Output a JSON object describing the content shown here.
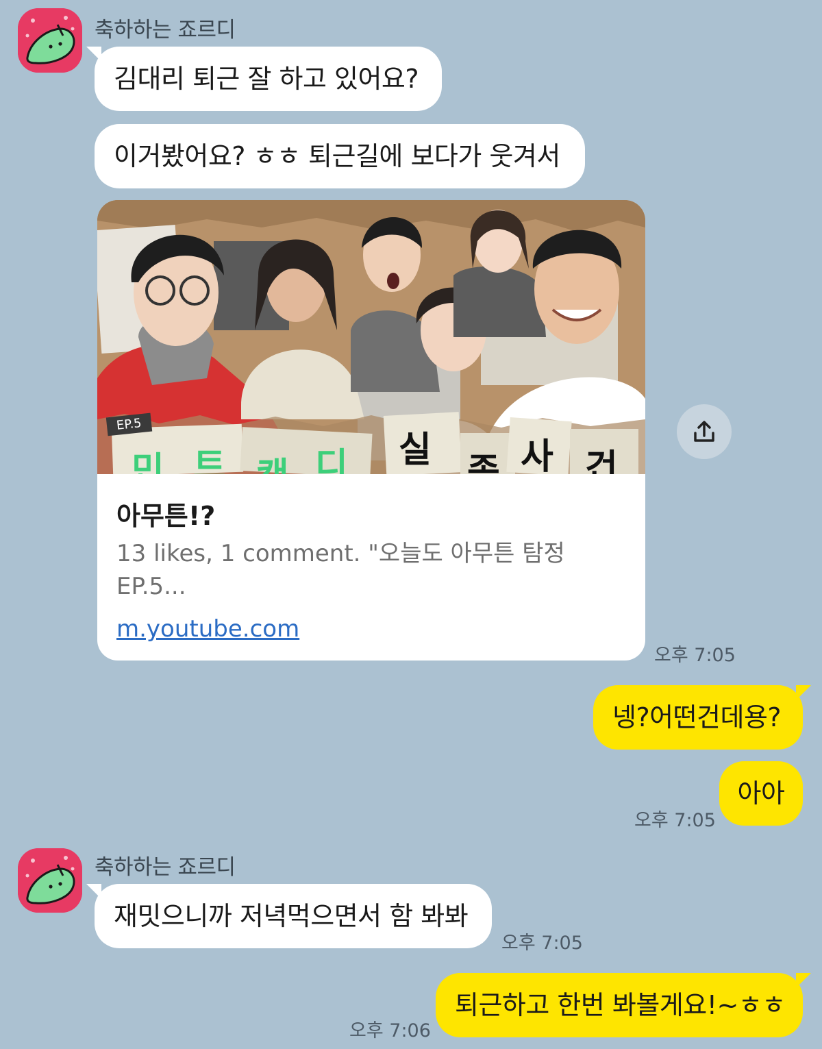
{
  "colors": {
    "background": "#abc1d1",
    "incoming_bubble": "#ffffff",
    "outgoing_bubble": "#fee500",
    "avatar": "#e73a63",
    "link": "#2b6cc4"
  },
  "messages": {
    "group1": {
      "sender": "축하하는 죠르디",
      "msg1": "김대리 퇴근 잘 하고 있어요?",
      "msg2": "이거봤어요? ㅎㅎ 퇴근길에 보다가 웃겨서",
      "link_card": {
        "badge": "EP.5",
        "thumbnail_caption": [
          "민",
          "트",
          "캔",
          "디",
          "실",
          "종",
          "사",
          "건"
        ],
        "title": "아무튼!?",
        "description": "13 likes, 1 comment. \"오늘도 아무튼 탐정 EP.5...",
        "url": "m.youtube.com",
        "share_icon": "share-icon"
      },
      "time": "오후 7:05"
    },
    "outgoing1": {
      "msg1": "넹?어떤건데용?",
      "msg2": "아아",
      "time": "오후 7:05"
    },
    "group2": {
      "sender": "축하하는 죠르디",
      "msg1": "재밋으니까 저녁먹으면서 함 봐봐",
      "time": "오후 7:05"
    },
    "outgoing2": {
      "msg1": "퇴근하고 한번 봐볼게요!~ㅎㅎ",
      "time": "오후 7:06"
    }
  }
}
